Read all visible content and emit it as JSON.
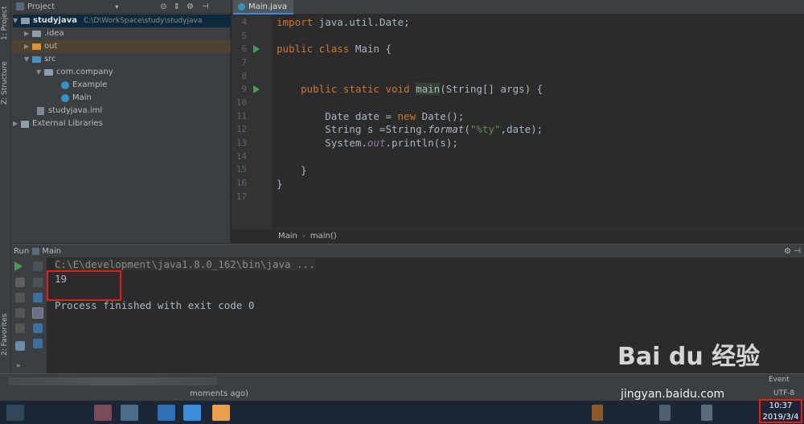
{
  "left_strip": {
    "project_label": "1: Project",
    "structure_label": "Z: Structure",
    "favorites_label": "2: Favorites"
  },
  "project_panel": {
    "title": "Project",
    "tree": [
      {
        "label": "studyjava",
        "extra": "C:\\D\\WorkSpace\\study\\studyjava",
        "type": "module"
      },
      {
        "label": ".idea",
        "type": "folder"
      },
      {
        "label": "out",
        "type": "folder-orange"
      },
      {
        "label": "src",
        "type": "folder-blue"
      },
      {
        "label": "com.company",
        "type": "package"
      },
      {
        "label": "Example",
        "type": "class"
      },
      {
        "label": "Main",
        "type": "class"
      },
      {
        "label": "studyjava.iml",
        "type": "file"
      },
      {
        "label": "External Libraries",
        "type": "library"
      }
    ]
  },
  "editor": {
    "tab_label": "Main.java",
    "line_numbers": [
      "4",
      "5",
      "6",
      "7",
      "8",
      "9",
      "10",
      "11",
      "12",
      "13",
      "14",
      "15",
      "16",
      "17"
    ],
    "breadcrumb": {
      "class": "Main",
      "method": "main()"
    }
  },
  "run_panel": {
    "label": "Run",
    "config": "Main",
    "console": {
      "command": "C:\\E\\development\\java1.8.0_162\\bin\\java ...",
      "output": "19",
      "finish": "Process finished with exit code 0"
    }
  },
  "status": {
    "event_label": "Event",
    "moments": "moments ago)",
    "encoding_hint": "UTF-8"
  },
  "watermark": {
    "brand": "Bai du 经验",
    "url": "jingyan.baidu.com"
  },
  "clock": {
    "time": "10:37",
    "date": "2019/3/4"
  },
  "colors": {
    "keyword": "#cc7832",
    "string": "#6a8759",
    "highlight_box": "#e0201e",
    "run_icon": "#499c54"
  }
}
